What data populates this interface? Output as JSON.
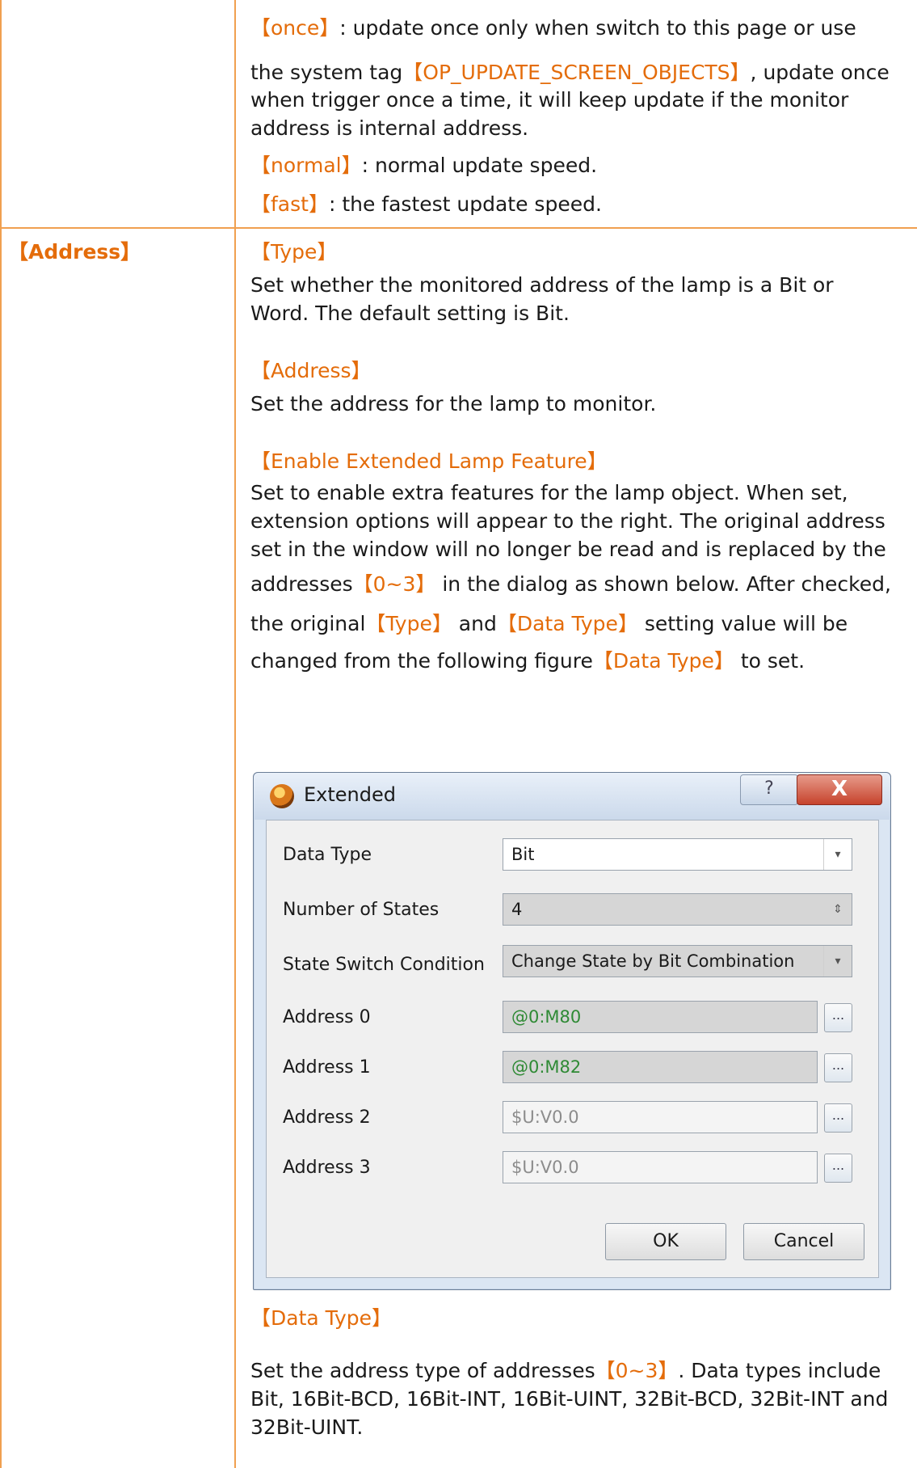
{
  "rows": [
    {
      "label": "",
      "lines": [
        [
          "【once】",
          ": update once only when switch to this page or use"
        ],
        [
          "the system tag",
          "【OP_UPDATE_SCREEN_OBJECTS】",
          ", update once"
        ],
        [
          "when trigger once a time, it will keep update if the monitor"
        ],
        [
          "address is internal address."
        ],
        [
          "【normal】",
          ": normal update speed."
        ],
        [
          "【fast】",
          ": the fastest update speed."
        ]
      ]
    }
  ],
  "address_section": {
    "label": "【Address】",
    "type_heading": "【Type】",
    "type_desc_1": "Set whether the monitored address of the lamp is a Bit or",
    "type_desc_2": "Word. The default setting is Bit.",
    "address_heading": "【Address】",
    "address_desc": "Set the address for the lamp to monitor.",
    "ext_heading": "【Enable Extended Lamp Feature】",
    "ext_desc_1": "Set to enable extra features for the lamp object. When set,",
    "ext_desc_2": "extension options will appear to the right. The original address",
    "ext_desc_3": "set in the window will no longer be read and is replaced by the",
    "ext_desc_4a": "addresses",
    "ext_desc_4b": "【0~3】",
    "ext_desc_4c": " in the dialog as shown below. After checked,",
    "ext_desc_5a": "the original",
    "ext_desc_5b": "【Type】",
    "ext_desc_5c": " and",
    "ext_desc_5d": "【Data Type】",
    "ext_desc_5e": " setting value will be",
    "ext_desc_6a": "changed from the following figure",
    "ext_desc_6b": "【Data Type】",
    "ext_desc_6c": " to set.",
    "dtype_heading": "【Data Type】",
    "dtype_desc_1a": "Set the address type of addresses",
    "dtype_desc_1b": "【0~3】",
    "dtype_desc_1c": ". Data types include",
    "dtype_desc_2": "Bit, 16Bit-BCD, 16Bit-INT, 16Bit-UINT, 32Bit-BCD, 32Bit-INT and",
    "dtype_desc_3": "32Bit-UINT."
  },
  "update_lines": {
    "once_tag": "【once】",
    "once_text": ": update once only when switch to this page or use",
    "sys_text": "the system tag",
    "sys_tag": "【OP_UPDATE_SCREEN_OBJECTS】",
    "sys_after": ", update once",
    "line3": "when trigger once a time, it will keep update if the monitor",
    "line4": "address is internal address.",
    "normal_tag": "【normal】",
    "normal_text": ": normal update speed.",
    "fast_tag": "【fast】",
    "fast_text": ": the fastest update speed."
  },
  "dialog": {
    "title": "Extended",
    "help": "?",
    "close": "X",
    "data_type_label": "Data Type",
    "data_type_value": "Bit",
    "states_label": "Number of States",
    "states_value": "4",
    "switch_label": "State Switch Condition",
    "switch_value": "Change State by Bit Combination",
    "addr0_label": "Address 0",
    "addr0_value": "@0:M80",
    "addr1_label": "Address 1",
    "addr1_value": "@0:M82",
    "addr2_label": "Address 2",
    "addr2_value": "$U:V0.0",
    "addr3_label": "Address 3",
    "addr3_value": "$U:V0.0",
    "browse": "...",
    "ok": "OK",
    "cancel": "Cancel",
    "dropdown_arrow": "▾",
    "spinner_arrow": "⇕"
  }
}
